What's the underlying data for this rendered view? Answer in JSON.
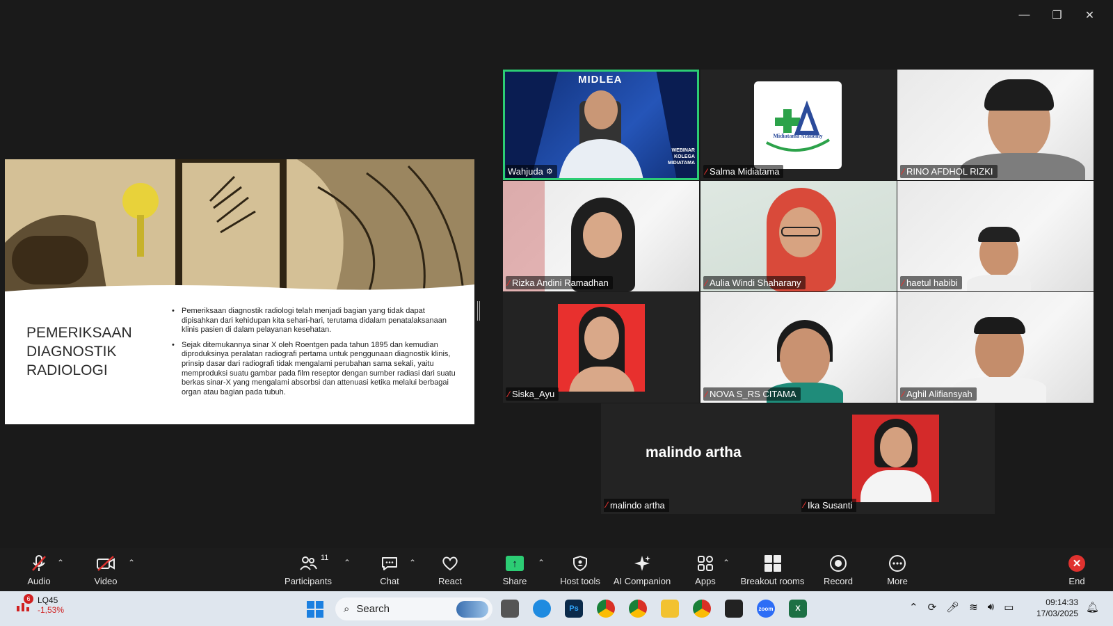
{
  "window": {
    "minimize": "—",
    "restore": "❐",
    "close": "✕"
  },
  "slide": {
    "title": "PEMERIKSAAN DIAGNOSTIK RADIOLOGI",
    "bullets": [
      "Pemeriksaan diagnostik radiologi telah menjadi bagian yang tidak dapat dipisahkan dari kehidupan kita sehari-hari, terutama didalam penatalaksanaan klinis pasien di dalam pelayanan kesehatan.",
      "Sejak ditemukannya sinar X oleh Roentgen pada tahun 1895 dan kemudian diproduksinya peralatan radiografi pertama untuk penggunaan diagnostik klinis, prinsip dasar dari radiografi tidak mengalami perubahan sama sekali, yaitu memproduksi suatu gambar pada film reseptor dengan sumber radiasi dari suatu berkas sinar-X yang mengalami absorbsi dan attenuasi ketika melalui berbagai organ atau bagian pada tubuh."
    ]
  },
  "participants": [
    {
      "name": "Wahjuda",
      "muted": false,
      "active": true,
      "banner": "MIDLEA",
      "banner_sub": "WEBINAR KOLEGA MIDIATAMA"
    },
    {
      "name": "Salma Midiatama",
      "muted": true,
      "logo_text": "Midiatama Academy"
    },
    {
      "name": "RINO AFDHOL RIZKI",
      "muted": true
    },
    {
      "name": "Rizka Andini Ramadhan",
      "muted": true
    },
    {
      "name": "Aulia Windi Shaharany",
      "muted": true
    },
    {
      "name": "haetul habibi",
      "muted": true
    },
    {
      "name": "Siska_Ayu",
      "muted": true
    },
    {
      "name": "NOVA S_RS CITAMA",
      "muted": true
    },
    {
      "name": "Aghil Alifiansyah",
      "muted": true
    },
    {
      "name": "malindo artha",
      "muted": true,
      "display_text": "malindo artha"
    },
    {
      "name": "Ika Susanti",
      "muted": true
    }
  ],
  "toolbar": {
    "audio": "Audio",
    "video": "Video",
    "participants": "Participants",
    "participants_count": "11",
    "chat": "Chat",
    "react": "React",
    "share": "Share",
    "host_tools": "Host tools",
    "ai_companion": "AI Companion",
    "apps": "Apps",
    "breakout_rooms": "Breakout rooms",
    "record": "Record",
    "more": "More",
    "end": "End"
  },
  "taskbar": {
    "stock_symbol": "LQ45",
    "stock_change": "-1,53%",
    "stock_badge": "6",
    "search_placeholder": "Search",
    "time": "09:14:33",
    "date": "17/03/2025"
  },
  "colors": {
    "active_speaker": "#2ccd74",
    "muted": "#e0322f",
    "share": "#2ccd74",
    "end": "#e0322f"
  }
}
